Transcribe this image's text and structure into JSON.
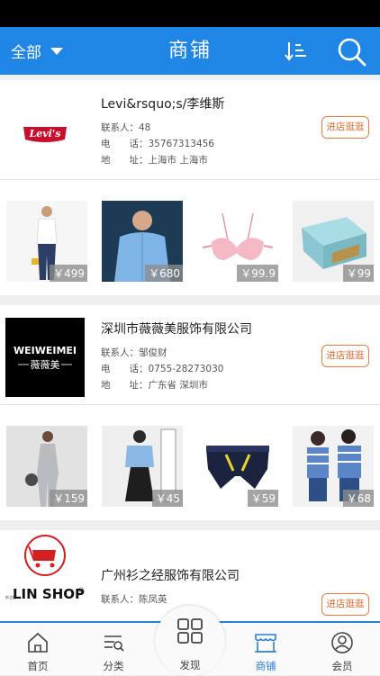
{
  "header": {
    "filter_label": "全部",
    "title": "商铺"
  },
  "shops": [
    {
      "name": "Levi&rsquo;s/李维斯",
      "contact_label": "联系人：",
      "contact": "48",
      "phone_label": "电　　话：",
      "phone": "35767313456",
      "address_label": "地　　址：",
      "address": "上海市 上海市",
      "enter_label": "进店逛逛",
      "logo_text": "Levi's",
      "products": [
        {
          "price": "￥499",
          "icon": "woman-jeans-photo"
        },
        {
          "price": "￥680",
          "icon": "man-blue-shirt-photo"
        },
        {
          "price": "￥99.9",
          "icon": "pink-bra-photo"
        },
        {
          "price": "￥99",
          "icon": "shoe-box-photo"
        }
      ]
    },
    {
      "name": "深圳市薇薇美服饰有限公司",
      "contact_label": "联系人：",
      "contact": "邹俊财",
      "phone_label": "电　　话：",
      "phone": "0755-28273030",
      "address_label": "地　　址：",
      "address": "广东省 深圳市",
      "enter_label": "进店逛逛",
      "logo_text": "WEIWEIMEI",
      "logo_sub": "薇薇美",
      "products": [
        {
          "price": "￥159",
          "icon": "woman-jumpsuit-photo"
        },
        {
          "price": "￥45",
          "icon": "woman-blue-uniform-photo"
        },
        {
          "price": "￥59",
          "icon": "boxer-briefs-photo"
        },
        {
          "price": "￥68",
          "icon": "couple-striped-shirts-photo"
        }
      ]
    },
    {
      "name": "广州衫之经服饰有限公司",
      "contact_label": "联系人：",
      "contact": "陈凤英",
      "enter_label": "进店逛逛",
      "logo_text": "LIN SHOP",
      "logo_sup": "®",
      "logo_small": "衫之经"
    }
  ],
  "tabs": [
    {
      "label": "首页",
      "icon": "home-icon"
    },
    {
      "label": "分类",
      "icon": "category-icon"
    },
    {
      "label": "发现",
      "icon": "discover-grid-icon"
    },
    {
      "label": "商铺",
      "icon": "shop-icon"
    },
    {
      "label": "会员",
      "icon": "member-icon"
    }
  ],
  "colors": {
    "header_bg": "#1f86e6",
    "active_tab": "#2b7fd8",
    "enter_button": "#e8652a"
  }
}
